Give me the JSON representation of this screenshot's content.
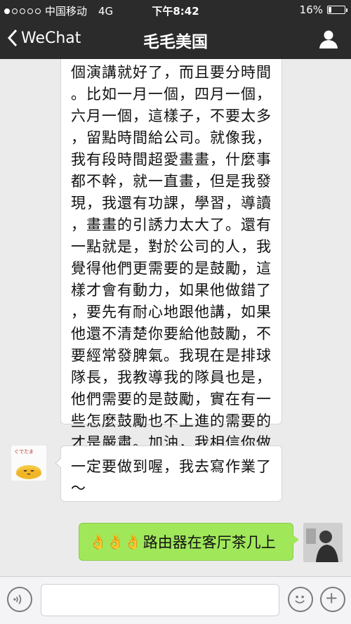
{
  "status_bar": {
    "carrier": "中国移动",
    "network": "4G",
    "time": "下午8:42",
    "battery": "16%",
    "battery_level": 0.16
  },
  "nav": {
    "back_label": "WeChat",
    "title": "毛毛美国"
  },
  "messages": [
    {
      "direction": "incoming",
      "text": "個演講就好了，而且要分時間\n。比如一月一個，四月一個，\n六月一個，這樣子，不要太多\n，留點時間給公司。就像我，\n我有段時間超愛畫畫，什麼事\n都不幹，就一直畫，但是我發\n現，我還有功課，學習，導讀\n，畫畫的引誘力太大了。還有\n一點就是，對於公司的人，我\n覺得他們更需要的是鼓勵，這\n樣才會有動力，如果他做錯了\n，要先有耐心地跟他講，如果\n他還不清楚你要給他鼓勵，不\n要經常發脾氣。我現在是排球\n隊長，我教導我的隊員也是，\n他們需要的是鼓勵，實在有一\n些怎麼鼓勵也不上進的需要的\n才是嚴肅。加油，我相信你做\n得到！"
    },
    {
      "direction": "incoming",
      "avatar_text": "ぐでたま",
      "text": "一定要做到喔，我去寫作業了\n～"
    },
    {
      "direction": "outgoing",
      "emoji": "👌👌👌",
      "text": "路由器在客厅茶几上"
    }
  ],
  "input_bar": {
    "placeholder": ""
  },
  "colors": {
    "navbar_bg": "#2b2b2b",
    "chat_bg": "#ebebeb",
    "outgoing_bubble": "#a0e75a",
    "incoming_bubble": "#ffffff"
  }
}
